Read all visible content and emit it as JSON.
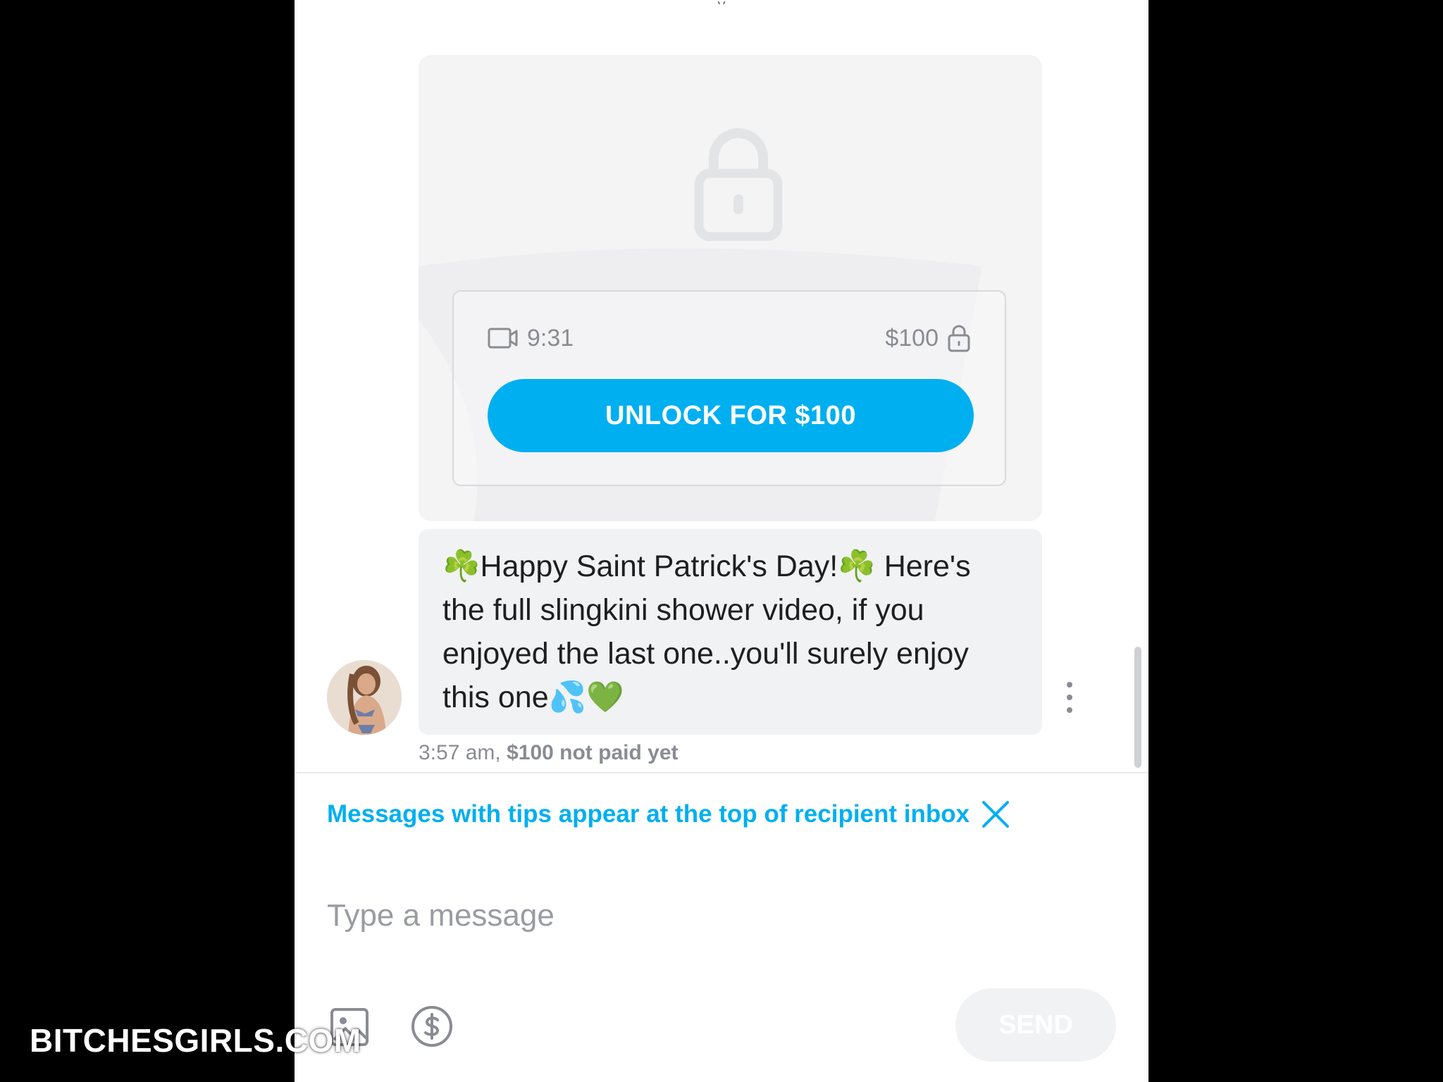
{
  "top_glyph": "y",
  "media": {
    "duration": "9:31",
    "price": "$100",
    "unlock_label": "UNLOCK FOR $100"
  },
  "message": {
    "text": "☘️Happy Saint Patrick's Day!☘️ Here's the full slingkini shower video, if you enjoyed the last one..you'll surely enjoy this one💦💚",
    "time": "3:57 am,",
    "status": "$100 not paid yet"
  },
  "tip_banner": {
    "text": "Messages with tips appear at the top of recipient inbox"
  },
  "composer": {
    "placeholder": "Type a message",
    "send_label": "SEND"
  },
  "watermark": "BITCHESGIRLS.COM",
  "icons": {
    "lock": "lock-icon",
    "video": "video-camera-icon",
    "price_lock": "padlock-icon",
    "more": "more-vertical-icon",
    "close": "close-icon",
    "image": "image-icon",
    "tip": "dollar-circle-icon"
  },
  "colors": {
    "accent": "#00aff0",
    "muted_text": "#8a8c93",
    "bubble_bg": "#f1f2f4",
    "card_bg": "#f4f4f5"
  }
}
